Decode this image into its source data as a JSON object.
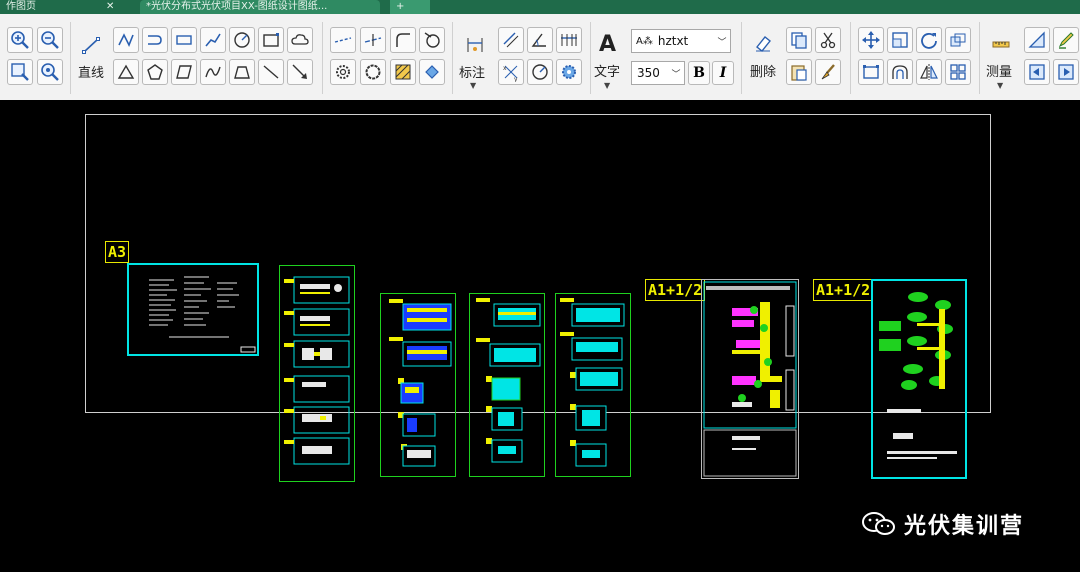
{
  "tabs": [
    {
      "label": "作图页"
    },
    {
      "label": "*光伏分布式光伏项目XX-图纸设计图纸..."
    }
  ],
  "toolbar": {
    "line_label": "直线",
    "dimension_label": "标注",
    "text_label": "文字",
    "delete_label": "删除",
    "measure_label": "测量",
    "font_style_value": "hztxt",
    "text_height_value": "350",
    "bold_label": "B",
    "italic_label": "I",
    "text_glyph": "A"
  },
  "drawing": {
    "tags": [
      "A3",
      "A1+1/2",
      "A1+1/2"
    ]
  },
  "watermark": {
    "text": "光伏集训营"
  },
  "colors": {
    "tabbar": "#1f6b4a",
    "ribbon": "#f2f2f2",
    "canvas": "#000000",
    "sheet_cyan": "#00e5e5",
    "sheet_green": "#1fd11f",
    "tag_yellow": "#f0f000"
  },
  "icons": [
    "zoom-in-icon",
    "zoom-out-icon",
    "zoom-window-icon",
    "zoom-realtime-icon",
    "line-icon",
    "polyline-icon",
    "circle-icon",
    "rectangle-icon",
    "text-icon",
    "pen-icon",
    "copy-icon",
    "scissors-icon",
    "move-icon",
    "rotate-icon",
    "ruler-icon"
  ]
}
